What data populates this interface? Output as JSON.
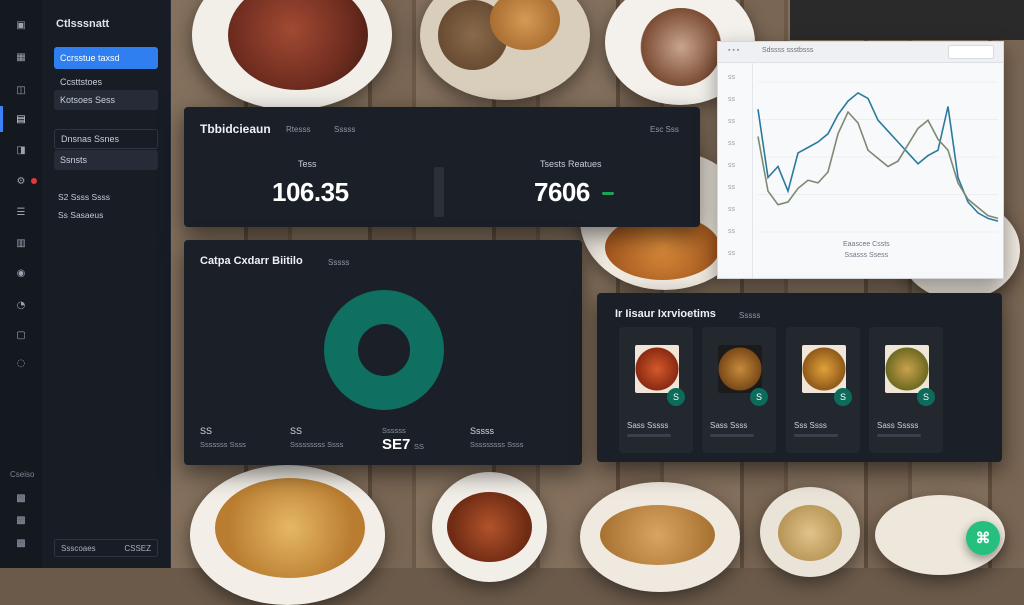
{
  "sidebar": {
    "title": "Ctlsssnatt",
    "items": [
      {
        "label": "Ccrsstue taxsd"
      },
      {
        "label": "Ccsttstoes"
      },
      {
        "label": "Kotsoes Sess"
      },
      {
        "label": "Dnsnas Ssnes"
      },
      {
        "label": "Ssnsts"
      }
    ],
    "sub_items": [
      "S2 Ssss Ssss",
      "Ss Sasaeus"
    ],
    "footer": {
      "label": "Ssscoaes",
      "meta": "CSSEZ"
    }
  },
  "rail_icons": [
    "home-icon",
    "grid-icon",
    "dashboard-icon",
    "report-icon",
    "alert-icon",
    "settings-icon",
    "list-icon",
    "chart-icon",
    "users-icon",
    "bell-icon"
  ],
  "rail_bottom_label": "Cseiso",
  "kpi_panel": {
    "title": "Tbbidcieaun",
    "title_suffix": "Rtesss",
    "meta": "Sssss",
    "controls": "Esc  Sss",
    "metrics": [
      {
        "label": "Tess",
        "value": "106.35"
      },
      {
        "label": "Tsests Reatues",
        "value": "7606"
      }
    ],
    "trend_color": "#1ea35a"
  },
  "chart_window": {
    "toolbar_text": "Sdssss ssstbsss",
    "side_labels": [
      "ss",
      "ss",
      "ss",
      "ss",
      "ss",
      "ss",
      "ss",
      "ss",
      "ss"
    ],
    "caption": [
      "Eaascee Cssts",
      "Ssasss Ssess"
    ],
    "line_colors": [
      "#2b7a9e",
      "#7c8a73"
    ]
  },
  "chart_data": {
    "type": "line",
    "x": [
      0,
      1,
      2,
      3,
      4,
      5,
      6,
      7,
      8,
      9,
      10,
      11,
      12,
      13,
      14,
      15,
      16,
      17,
      18,
      19,
      20,
      21,
      22,
      23,
      24
    ],
    "series": [
      {
        "values": [
          90,
          40,
          48,
          30,
          58,
          62,
          66,
          72,
          86,
          96,
          102,
          98,
          82,
          74,
          66,
          58,
          50,
          56,
          60,
          92,
          40,
          22,
          14,
          10,
          8
        ]
      },
      {
        "values": [
          70,
          30,
          20,
          22,
          32,
          38,
          36,
          44,
          72,
          88,
          80,
          60,
          54,
          48,
          52,
          64,
          76,
          82,
          68,
          60,
          36,
          24,
          18,
          12,
          10
        ]
      }
    ]
  },
  "donut_panel": {
    "title": "Catpa Cxdarr Biitilo",
    "meta": "Sssss",
    "accent": "#0f6f60",
    "legend": [
      {
        "value": "SS",
        "label": "Sssssss Ssss"
      },
      {
        "value": "SS",
        "label": "Sssssssss Ssss"
      },
      {
        "value": "SE7",
        "label": "Ssssss",
        "extra": "SS"
      },
      {
        "value": "Sssss",
        "label": "Sssssssss Ssss"
      }
    ]
  },
  "recs_panel": {
    "title": "Ir Iisaur Ixrvioetims",
    "meta": "Sssss",
    "cards": [
      {
        "label": "Sass Sssss",
        "badge": "S"
      },
      {
        "label": "Sass Ssss",
        "badge": "S"
      },
      {
        "label": "Sss Ssss",
        "badge": "S"
      },
      {
        "label": "Sass Sssss",
        "badge": "S"
      }
    ]
  },
  "fab": {
    "icon": "chat-icon",
    "color": "#25c07d"
  }
}
